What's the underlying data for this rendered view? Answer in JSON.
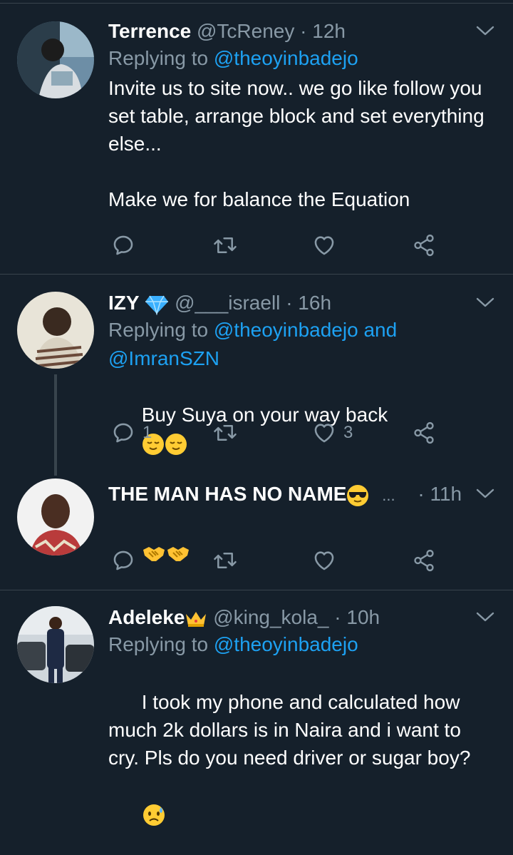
{
  "tweets": [
    {
      "name": "Terrence",
      "handle": "@TcReney",
      "dot": "·",
      "time": "12h",
      "replying_prefix": "Replying to",
      "replying_to": "@theoyinbadejo",
      "text": "Invite us to site now.. we go like follow you set table, arrange block and set everything else...\n\nMake we for balance the Equation",
      "reply_count": "",
      "like_count": ""
    },
    {
      "name": "IZY",
      "handle": "@___israell",
      "dot": "·",
      "time": "16h",
      "replying_prefix": "Replying to",
      "replying_to": "@theoyinbadejo and",
      "replying_to_2": "@ImranSZN",
      "text": "Buy Suya on your way back",
      "reply_count": "1",
      "like_count": "3"
    },
    {
      "name": "THE MAN HAS NO NAME",
      "ellipsis": "...",
      "dot": "·",
      "time": "11h",
      "reply_count": "",
      "like_count": ""
    },
    {
      "name": "Adeleke",
      "handle": "@king_kola_",
      "dot": "·",
      "time": "10h",
      "replying_prefix": "Replying to",
      "replying_to": "@theoyinbadejo",
      "text": "I took my phone and calculated how much 2k dollars is in Naira and i want to cry. Pls do you need driver or sugar boy?"
    }
  ],
  "colors": {
    "background": "#15202b",
    "secondary_text": "#8899a6",
    "link": "#1da1f2",
    "divider": "#38444d"
  },
  "icons": [
    "reply-icon",
    "retweet-icon",
    "like-icon",
    "share-icon",
    "chevron-down-icon",
    "verified-diamond-icon",
    "sunglasses-emoji-icon",
    "crown-emoji-icon",
    "relieved-emoji-icon",
    "handshake-emoji-icon",
    "anxious-sweat-emoji-icon"
  ]
}
